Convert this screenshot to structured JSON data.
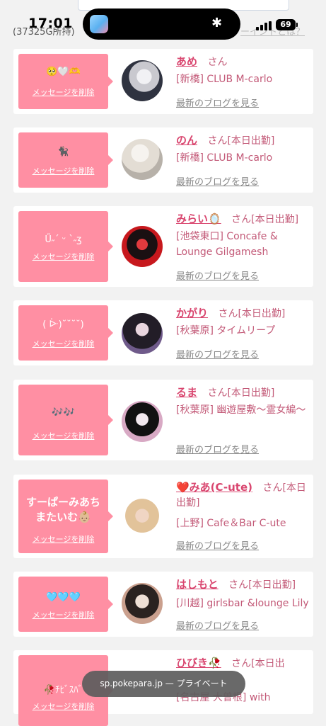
{
  "status": {
    "time": "17:01",
    "battery": "69",
    "points": "(37325G所持)",
    "what_link": "ーイントとは？"
  },
  "browser": {
    "url": "sp.pokepara.jp",
    "mode": "— プライベート"
  },
  "labels": {
    "delete": "メッセージを削除",
    "blog": "最新のブログを見る",
    "san": "さん"
  },
  "cards": [
    {
      "message": "🥺🤍🫶",
      "name": "あめ",
      "status": "",
      "shop": "[新橋] CLUB M-carlo",
      "avatar_colors": [
        "#2f3340",
        "#c9c9cf",
        "#f1f1f4"
      ]
    },
    {
      "message": "🐈‍⬛",
      "name": "のん",
      "status": "[本日出勤]",
      "shop": "[新橋] CLUB M-carlo",
      "avatar_colors": [
        "#b7b1a9",
        "#e3ddd4",
        "#f6f3ef"
      ]
    },
    {
      "message": "Ű˶ˊ ᵕ ˋ˶ʒ",
      "name": "みらい🪞",
      "status": "[本日出勤]",
      "shop": "[池袋東口] Concafe & Lounge Gilgamesh",
      "avatar_colors": [
        "#1a1012",
        "#c7181d",
        "#e23a3e"
      ]
    },
    {
      "message": "( ᐕ)˘˘˘˘)",
      "name": "かがり",
      "status": "[本日出勤]",
      "shop": "[秋葉原] タイムリープ",
      "avatar_colors": [
        "#221d27",
        "#6f5a8a",
        "#e9d6df"
      ]
    },
    {
      "message": "🎶🎶",
      "name": "るま",
      "status": "[本日出勤]",
      "shop": "[秋葉原] 幽遊屋敷〜霊女編〜",
      "avatar_colors": [
        "#111111",
        "#d8a9c4",
        "#f2e8ee"
      ]
    },
    {
      "message": "すーぱーみあちまたいむ👶🏼",
      "name": "❤️みあ(C-ute)",
      "status": "[本日出勤]",
      "shop": "[上野] Cafe＆Bar C-ute",
      "avatar_colors": [
        "#f0d5c4",
        "#e2c39a",
        "#ffffff"
      ]
    },
    {
      "message": "🩵🩵🩵",
      "name": "はしもと",
      "status": "[本日出勤]",
      "shop": "[川越] girlsbar &lounge Lily",
      "avatar_colors": [
        "#2a2220",
        "#caa08e",
        "#efe0d6"
      ]
    },
    {
      "message": "🥀ﾁﾋﾞｽﾊﾞ",
      "name": "ひびき🥀",
      "status": "[本日出",
      "shop": "[名古屋 大曽根] with",
      "avatar_colors": [
        "#333",
        "#999",
        "#ddd"
      ]
    }
  ]
}
